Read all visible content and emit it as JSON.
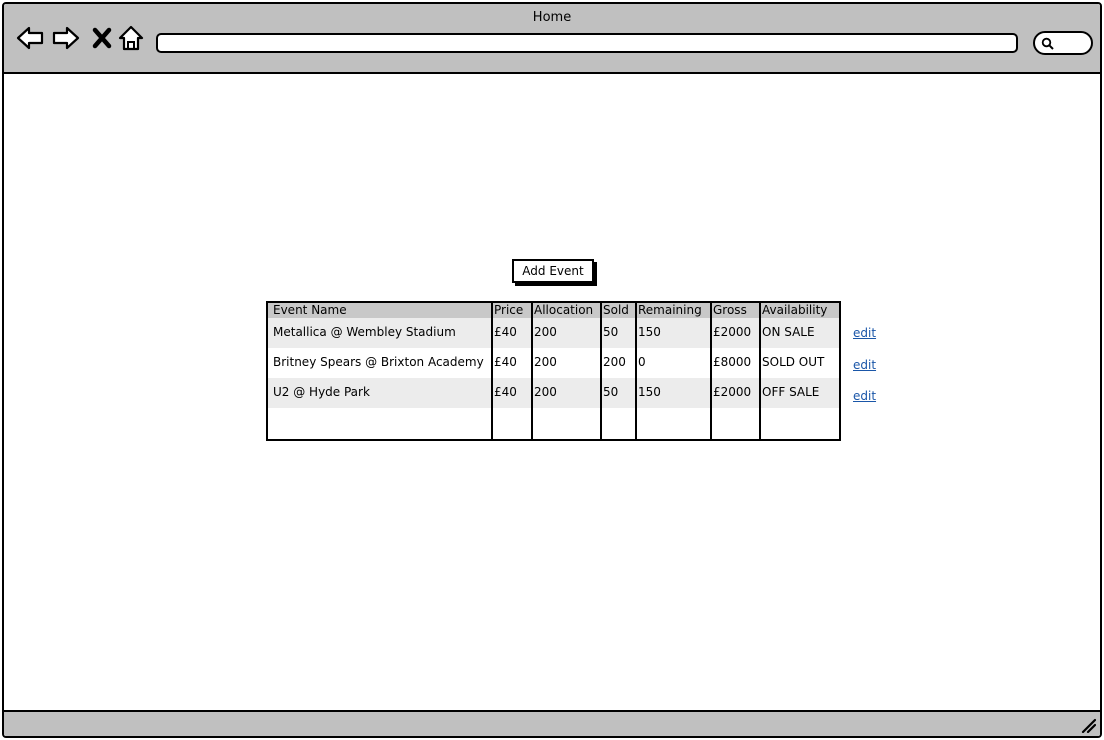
{
  "window": {
    "title": "Home"
  },
  "toolbar": {
    "back_icon": "back-arrow-icon",
    "forward_icon": "forward-arrow-icon",
    "stop_icon": "close-icon",
    "home_icon": "home-icon",
    "address": "",
    "search_icon": "search-icon"
  },
  "main": {
    "add_button_label": "Add Event",
    "table": {
      "headers": [
        "Event Name",
        "Price",
        "Allocation",
        "Sold",
        "Remaining",
        "Gross",
        "Availability"
      ],
      "rows": [
        {
          "name": "Metallica @ Wembley Stadium",
          "price": "£40",
          "allocation": "200",
          "sold": "50",
          "remaining": "150",
          "gross": "£2000",
          "availability": "ON SALE",
          "action": "edit"
        },
        {
          "name": "Britney Spears @ Brixton Academy",
          "price": "£40",
          "allocation": "200",
          "sold": "200",
          "remaining": "0",
          "gross": "£8000",
          "availability": "SOLD OUT",
          "action": "edit"
        },
        {
          "name": "U2 @ Hyde Park",
          "price": "£40",
          "allocation": "200",
          "sold": "50",
          "remaining": "150",
          "gross": "£2000",
          "availability": "OFF SALE",
          "action": "edit"
        }
      ]
    }
  },
  "colors": {
    "chrome": "#c0c0c0",
    "header_row": "#c8c8c8",
    "striped_row": "#ececec",
    "link": "#1a56a8"
  }
}
